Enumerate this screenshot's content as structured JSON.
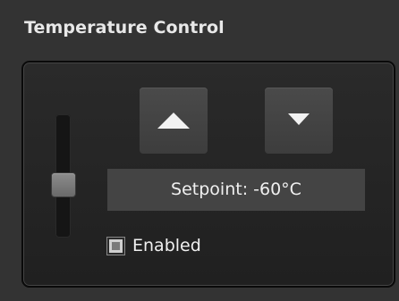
{
  "title": "Temperature Control",
  "controls": {
    "increase_icon": "triangle-up",
    "decrease_icon": "triangle-down",
    "setpoint_text": "Setpoint: -60°C",
    "enabled_label": "Enabled",
    "enabled_checked": true,
    "slider_level": 0.45
  },
  "colors": {
    "background": "#333333",
    "panel": "#242424",
    "button": "#444444",
    "text": "#f0f0f0"
  }
}
